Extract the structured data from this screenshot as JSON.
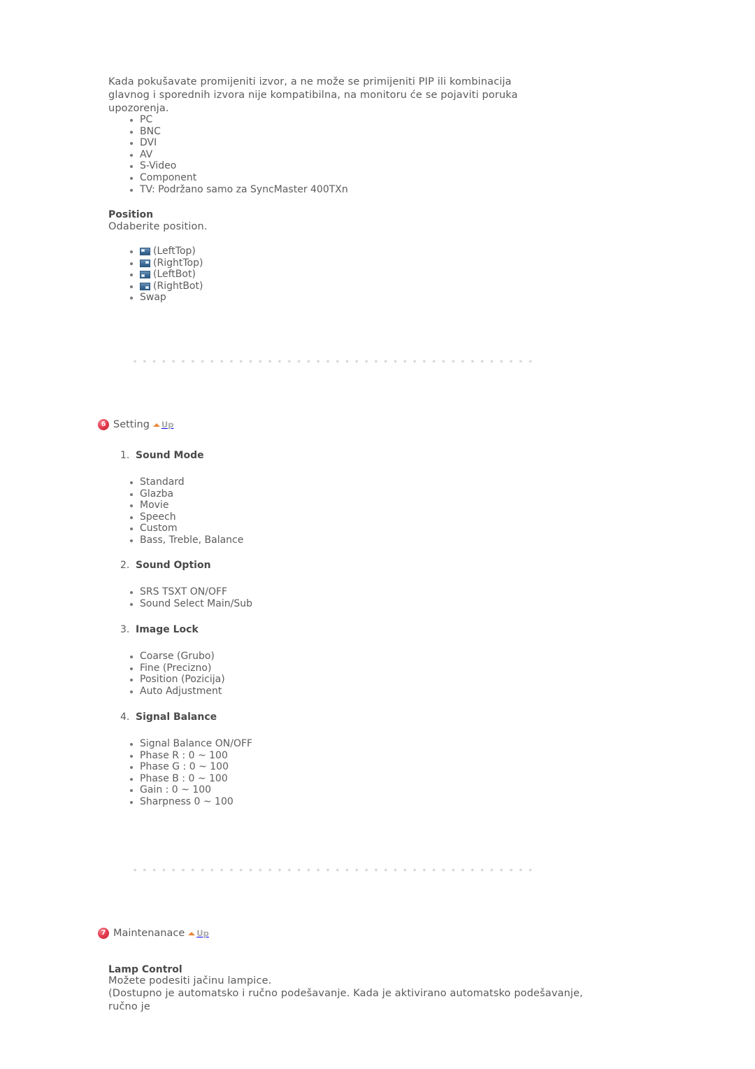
{
  "intro": {
    "paragraph": "Kada pokušavate promijeniti izvor, a ne može se primijeniti PIP ili kombinacija glavnog i sporednih izvora nije kompatibilna, na monitoru će se pojaviti poruka upozorenja.",
    "sources": [
      "PC",
      "BNC",
      "DVI",
      "AV",
      "S-Video",
      "Component",
      "TV: Podržano samo za SyncMaster 400TXn"
    ]
  },
  "position": {
    "heading": "Position",
    "description": "Odaberite position.",
    "options": [
      {
        "icon": "pip-lefttop-icon",
        "label": "(LeftTop)"
      },
      {
        "icon": "pip-righttop-icon",
        "label": "(RightTop)"
      },
      {
        "icon": "pip-leftbot-icon",
        "label": "(LeftBot)"
      },
      {
        "icon": "pip-rightbot-icon",
        "label": "(RightBot)"
      },
      {
        "icon": "",
        "label": "Swap"
      }
    ]
  },
  "setting": {
    "badge": "6",
    "title": "Setting",
    "up_label": "Up",
    "items": [
      {
        "number": "1.",
        "label": "Sound Mode",
        "bullets": [
          "Standard",
          "Glazba",
          "Movie",
          "Speech",
          "Custom",
          "Bass, Treble, Balance"
        ]
      },
      {
        "number": "2.",
        "label": "Sound Option",
        "bullets": [
          "SRS TSXT ON/OFF",
          "Sound Select Main/Sub"
        ]
      },
      {
        "number": "3.",
        "label": "Image Lock",
        "bullets": [
          "Coarse (Grubo)",
          "Fine (Precizno)",
          "Position (Pozicija)",
          "Auto Adjustment"
        ]
      },
      {
        "number": "4.",
        "label": "Signal Balance",
        "bullets": [
          "Signal Balance ON/OFF",
          "Phase R : 0 ~ 100",
          "Phase G : 0 ~ 100",
          "Phase B : 0 ~ 100",
          "Gain : 0 ~ 100",
          "Sharpness 0 ~ 100"
        ]
      }
    ]
  },
  "maintenance": {
    "badge": "7",
    "title": "Maintenanace",
    "up_label": "Up",
    "lamp_control": {
      "heading": "Lamp Control",
      "line1": "Možete podesiti jačinu lampice.",
      "line2": "(Dostupno je automatsko i ručno podešavanje. Kada je aktivirano automatsko podešavanje, ručno je"
    }
  },
  "colors": {
    "badge_red": "#e33a4e",
    "up_arrow_orange": "#e8863a",
    "pip_blue": "#3f6d99",
    "rule_gray": "#d9d9d9",
    "text_gray": "#5a5a5a"
  }
}
